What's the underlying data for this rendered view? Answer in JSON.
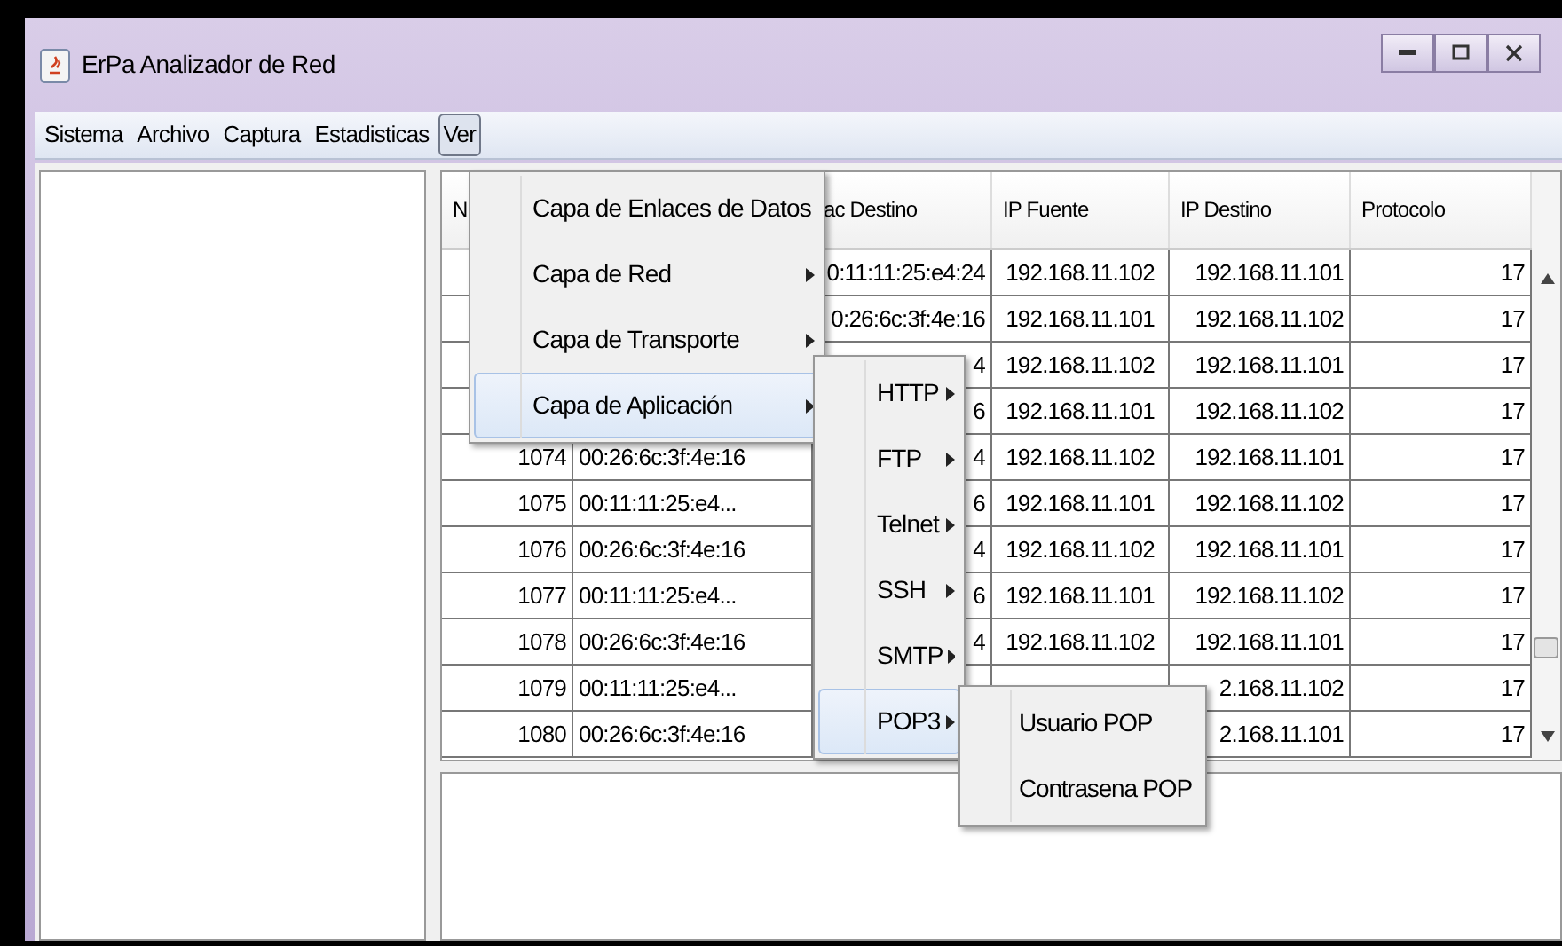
{
  "window": {
    "title": "ErPa Analizador de Red"
  },
  "menubar": [
    {
      "label": "Sistema",
      "selected": false
    },
    {
      "label": "Archivo",
      "selected": false
    },
    {
      "label": "Captura",
      "selected": false
    },
    {
      "label": "Estadisticas",
      "selected": false
    },
    {
      "label": "Ver",
      "selected": true
    }
  ],
  "table": {
    "header": {
      "column_1": "N",
      "column_3": "ac Destino",
      "column_4": "IP Fuente",
      "column_5": "IP Destino",
      "column_6": "Protocolo"
    },
    "rows": [
      {
        "column_3": "0:11:11:25:e4:24",
        "column_4": "192.168.11.102",
        "column_5": "192.168.11.101",
        "column_6": "17"
      },
      {
        "column_3": "0:26:6c:3f:4e:16",
        "column_4": "192.168.11.101",
        "column_5": "192.168.11.102",
        "column_6": "17"
      },
      {
        "column_3": "4",
        "column_4": "192.168.11.102",
        "column_5": "192.168.11.101",
        "column_6": "17"
      },
      {
        "column_3": "6",
        "column_4": "192.168.11.101",
        "column_5": "192.168.11.102",
        "column_6": "17"
      },
      {
        "column_1": "1074",
        "column_2": "00:26:6c:3f:4e:16",
        "column_3": "4",
        "column_4": "192.168.11.102",
        "column_5": "192.168.11.101",
        "column_6": "17"
      },
      {
        "column_1": "1075",
        "column_2": "00:11:11:25:e4...",
        "column_3": "6",
        "column_4": "192.168.11.101",
        "column_5": "192.168.11.102",
        "column_6": "17"
      },
      {
        "column_1": "1076",
        "column_2": "00:26:6c:3f:4e:16",
        "column_3": "4",
        "column_4": "192.168.11.102",
        "column_5": "192.168.11.101",
        "column_6": "17"
      },
      {
        "column_1": "1077",
        "column_2": "00:11:11:25:e4...",
        "column_3": "6",
        "column_4": "192.168.11.101",
        "column_5": "192.168.11.102",
        "column_6": "17"
      },
      {
        "column_1": "1078",
        "column_2": "00:26:6c:3f:4e:16",
        "column_3": "4",
        "column_4": "192.168.11.102",
        "column_5": "192.168.11.101",
        "column_6": "17"
      },
      {
        "column_1": "1079",
        "column_2": "00:11:11:25:e4...",
        "column_5": "2.168.11.102",
        "column_6": "17"
      },
      {
        "column_1": "1080",
        "column_2": "00:26:6c:3f:4e:16",
        "column_5": "2.168.11.101",
        "column_6": "17"
      }
    ]
  },
  "menus": [
    {
      "items": [
        {
          "label": "Capa de Enlaces de Datos",
          "selected": false
        },
        {
          "label": "Capa de Red",
          "selected": false
        },
        {
          "label": "Capa de Transporte",
          "selected": false
        },
        {
          "label": "Capa de Aplicación",
          "selected": true
        }
      ]
    },
    {
      "items": [
        {
          "label": "HTTP",
          "selected": false
        },
        {
          "label": "FTP",
          "selected": false
        },
        {
          "label": "Telnet",
          "selected": false
        },
        {
          "label": "SSH",
          "selected": false
        },
        {
          "label": "SMTP",
          "selected": false
        },
        {
          "label": "POP3",
          "selected": true
        }
      ]
    },
    {
      "items": [
        {
          "label": "Usuario POP",
          "selected": false
        },
        {
          "label": "Contrasena POP",
          "selected": false
        }
      ]
    }
  ]
}
